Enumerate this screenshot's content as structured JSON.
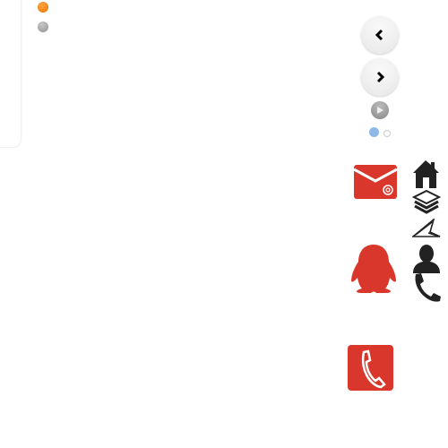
{
  "colors": {
    "accent_orange": "#f57c00",
    "inactive_gray": "#a0a0a0",
    "brand_red": "#d9372b",
    "icon_dark": "#222222",
    "indicator_active": "#8fb9e8"
  },
  "indicators": [
    {
      "state": "active",
      "color": "#f57c00"
    },
    {
      "state": "inactive",
      "color": "#a0a0a0"
    }
  ],
  "carousel": {
    "prev_icon": "chevron-left-icon",
    "next_icon": "chevron-right-icon",
    "play_icon": "play-icon",
    "page_dots": [
      {
        "active": true
      },
      {
        "active": false
      }
    ]
  },
  "app_icons": [
    "mail-icon",
    "qq-penguin-icon",
    "phone-app-icon"
  ],
  "side_icons": [
    "home-icon",
    "layers-icon",
    "paper-plane-icon",
    "user-icon",
    "phone-icon"
  ]
}
